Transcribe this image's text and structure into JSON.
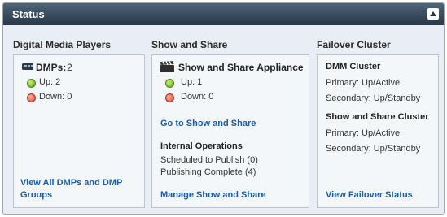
{
  "header": {
    "title": "Status"
  },
  "dmp": {
    "heading": "Digital Media Players",
    "dmps_label": "DMPs:",
    "dmps_count": "2",
    "up": "Up: 2",
    "down": "Down: 0",
    "link": "View All DMPs and DMP Groups"
  },
  "sas": {
    "heading": "Show and Share",
    "appliance": "Show and Share Appliance",
    "up": "Up: 1",
    "down": "Down: 0",
    "go_link": "Go to Show and Share",
    "internal_title": "Internal Operations",
    "scheduled": "Scheduled to Publish (0)",
    "complete": "Publishing Complete (4)",
    "manage_link": "Manage Show and Share"
  },
  "failover": {
    "heading": "Failover Cluster",
    "dmm_title": "DMM Cluster",
    "dmm_primary": "Primary: Up/Active",
    "dmm_secondary": "Secondary: Up/Standby",
    "sas_title": "Show and Share Cluster",
    "sas_primary": "Primary: Up/Active",
    "sas_secondary": "Secondary: Up/Standby",
    "link": "View Failover Status"
  },
  "colors": {
    "header": "#263747",
    "link": "#1a5ea8",
    "up": "#5fa01a",
    "down": "#d5412c"
  },
  "icons": {
    "collapse": "chevron-up-icon",
    "dmp": "media-player-icon",
    "appliance": "clapperboard-icon"
  }
}
